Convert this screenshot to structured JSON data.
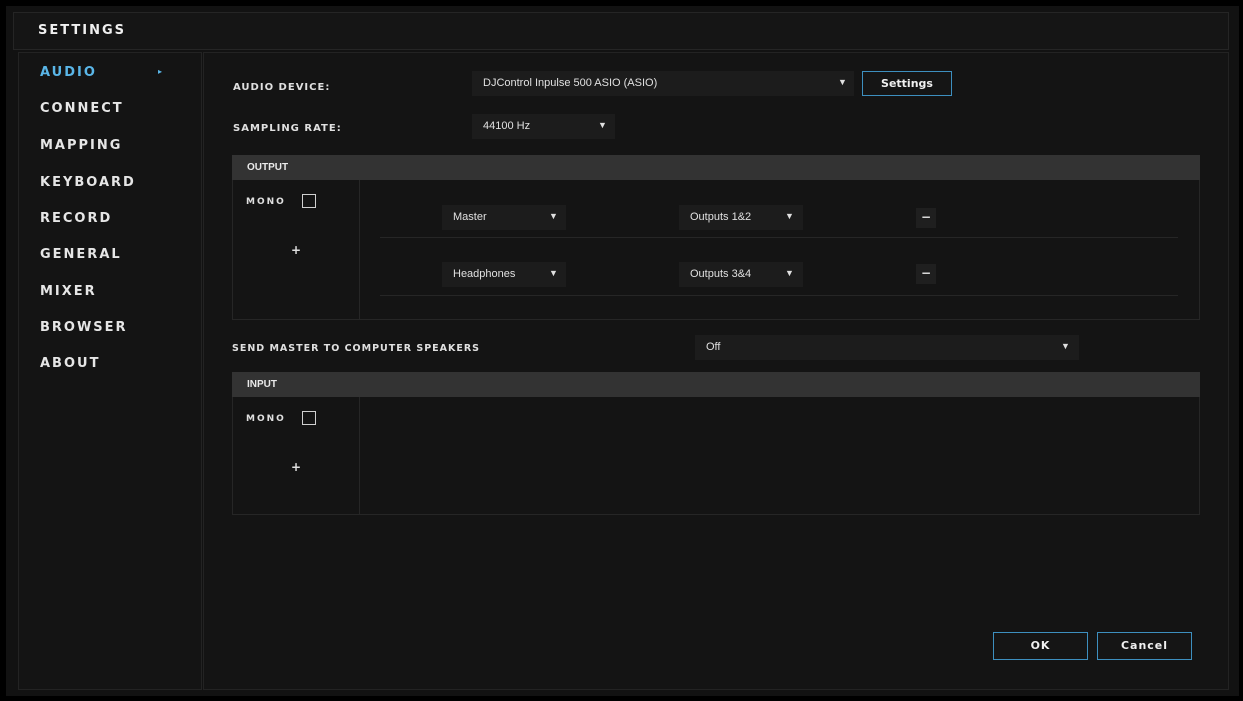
{
  "window": {
    "title": "SETTINGS"
  },
  "sidebar": {
    "items": [
      {
        "label": "AUDIO",
        "active": true
      },
      {
        "label": "CONNECT"
      },
      {
        "label": "MAPPING"
      },
      {
        "label": "KEYBOARD"
      },
      {
        "label": "RECORD"
      },
      {
        "label": "GENERAL"
      },
      {
        "label": "MIXER"
      },
      {
        "label": "BROWSER"
      },
      {
        "label": "ABOUT"
      }
    ]
  },
  "audio": {
    "device_label": "AUDIO DEVICE:",
    "device_value": "DJControl Inpulse 500 ASIO (ASIO)",
    "settings_button": "Settings",
    "sampling_label": "SAMPLING RATE:",
    "sampling_value": "44100 Hz"
  },
  "output": {
    "header": "OUTPUT",
    "mono_label": "MONO",
    "add_label": "+",
    "rows": [
      {
        "channel": "Master",
        "outputs": "Outputs 1&2",
        "remove": "−"
      },
      {
        "channel": "Headphones",
        "outputs": "Outputs 3&4",
        "remove": "−"
      }
    ]
  },
  "send_master": {
    "label": "SEND MASTER TO COMPUTER SPEAKERS",
    "value": "Off"
  },
  "input": {
    "header": "INPUT",
    "mono_label": "MONO",
    "add_label": "+"
  },
  "footer": {
    "ok_label": "OK",
    "cancel_label": "Cancel"
  },
  "colors": {
    "accent": "#5ab6e8",
    "button_border": "#3d8fbf",
    "background": "#141414",
    "header": "#333333"
  }
}
